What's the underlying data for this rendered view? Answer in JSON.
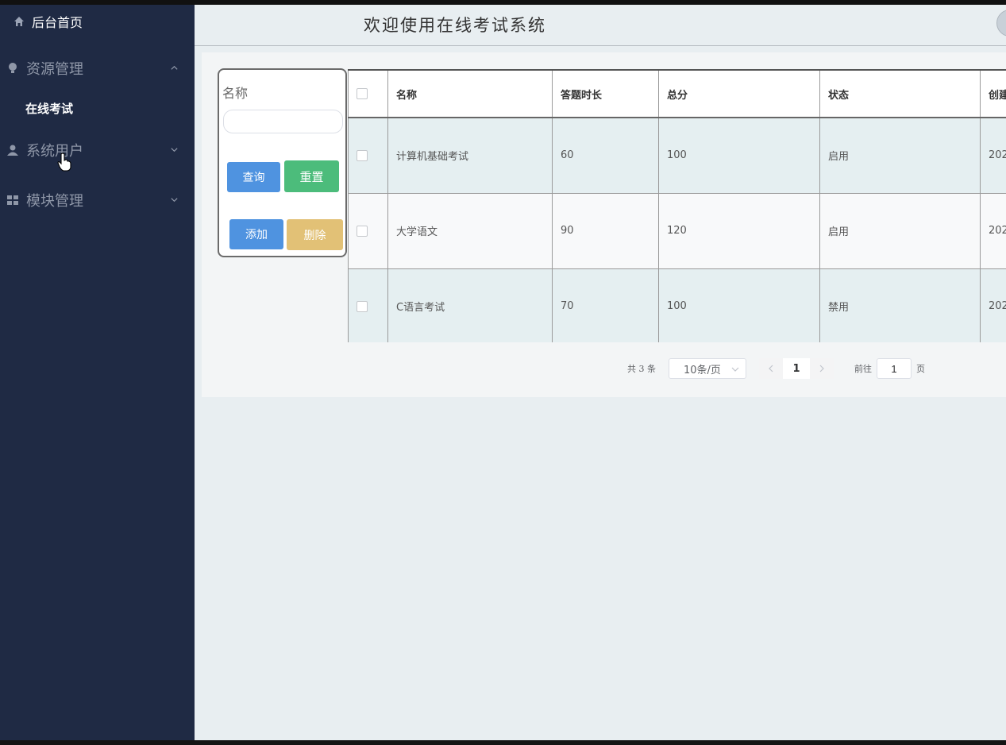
{
  "sidebar": {
    "home_label": "后台首页",
    "groups": [
      {
        "label": "资源管理",
        "icon": "lightbulb-icon",
        "expanded": true
      },
      {
        "label": "系统用户",
        "icon": "user-icon",
        "expanded": false
      },
      {
        "label": "模块管理",
        "icon": "grid-icon",
        "expanded": false
      }
    ],
    "active_item": "在线考试"
  },
  "header": {
    "title": "欢迎使用在线考试系统"
  },
  "search": {
    "label": "名称",
    "value": "",
    "query_label": "查询",
    "reset_label": "重置",
    "add_label": "添加",
    "delete_label": "删除"
  },
  "table": {
    "headers": [
      "名称",
      "答题时长",
      "总分",
      "状态",
      "创建"
    ],
    "rows": [
      {
        "name": "计算机基础考试",
        "duration": "60",
        "score": "100",
        "status": "启用",
        "created": "202"
      },
      {
        "name": "大学语文",
        "duration": "90",
        "score": "120",
        "status": "启用",
        "created": "202"
      },
      {
        "name": "C语言考试",
        "duration": "70",
        "score": "100",
        "status": "禁用",
        "created": "202"
      }
    ]
  },
  "pager": {
    "total": "共 3 条",
    "page_size": "10条/页",
    "current_page": "1",
    "goto_label": "前往",
    "goto_value": "1",
    "page_unit": "页"
  },
  "colors": {
    "sidebar_bg": "#1f2a44",
    "primary": "#4f93e0",
    "success": "#4cbc7b",
    "warning": "#e2c176"
  }
}
